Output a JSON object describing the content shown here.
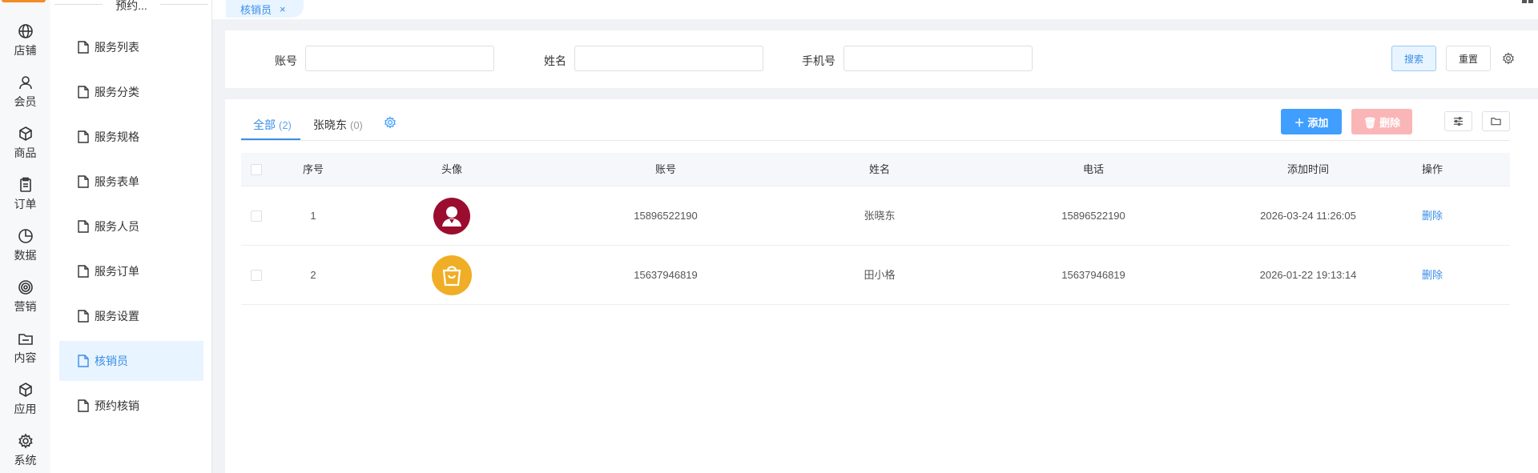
{
  "rail": {
    "items": [
      {
        "label": "店铺",
        "icon": "globe-icon"
      },
      {
        "label": "会员",
        "icon": "user-icon"
      },
      {
        "label": "商品",
        "icon": "box-icon"
      },
      {
        "label": "订单",
        "icon": "clipboard-icon"
      },
      {
        "label": "数据",
        "icon": "pie-chart-icon"
      },
      {
        "label": "营销",
        "icon": "target-icon"
      },
      {
        "label": "内容",
        "icon": "folder-icon"
      },
      {
        "label": "应用",
        "icon": "cube-icon"
      },
      {
        "label": "系统",
        "icon": "gear-icon"
      }
    ]
  },
  "subnav": {
    "title": "预约...",
    "items": [
      {
        "label": "服务列表"
      },
      {
        "label": "服务分类"
      },
      {
        "label": "服务规格"
      },
      {
        "label": "服务表单"
      },
      {
        "label": "服务人员"
      },
      {
        "label": "服务订单"
      },
      {
        "label": "服务设置"
      },
      {
        "label": "核销员",
        "active": true
      },
      {
        "label": "预约核销"
      }
    ]
  },
  "tabs": [
    {
      "label": "核销员",
      "close": "×"
    }
  ],
  "search": {
    "fields": [
      {
        "label": "账号",
        "value": "",
        "placeholder": ""
      },
      {
        "label": "姓名",
        "value": "",
        "placeholder": ""
      },
      {
        "label": "手机号",
        "value": "",
        "placeholder": ""
      }
    ],
    "search_label": "搜索",
    "reset_label": "重置"
  },
  "filter_tabs": [
    {
      "label": "全部",
      "count": "(2)",
      "active": true
    },
    {
      "label": "张晓东",
      "count": "(0)"
    }
  ],
  "toolbar": {
    "add_label": "添加",
    "delete_label": "删除"
  },
  "table": {
    "columns": [
      "序号",
      "头像",
      "账号",
      "姓名",
      "电话",
      "添加时间",
      "操作"
    ],
    "rows": [
      {
        "index": "1",
        "avatar": "person-avatar",
        "avatar_color": "#9b0d2e",
        "account": "15896522190",
        "name": "张晓东",
        "phone": "15896522190",
        "added": "2026-03-24 11:26:05",
        "action": "删除"
      },
      {
        "index": "2",
        "avatar": "bag-avatar",
        "avatar_color": "#f0ae26",
        "account": "15637946819",
        "name": "田小格",
        "phone": "15637946819",
        "added": "2026-01-22 19:13:14",
        "action": "删除"
      }
    ]
  },
  "colors": {
    "accent": "#409eff",
    "danger_light": "#fab6b6",
    "brand": "#f28c28"
  }
}
